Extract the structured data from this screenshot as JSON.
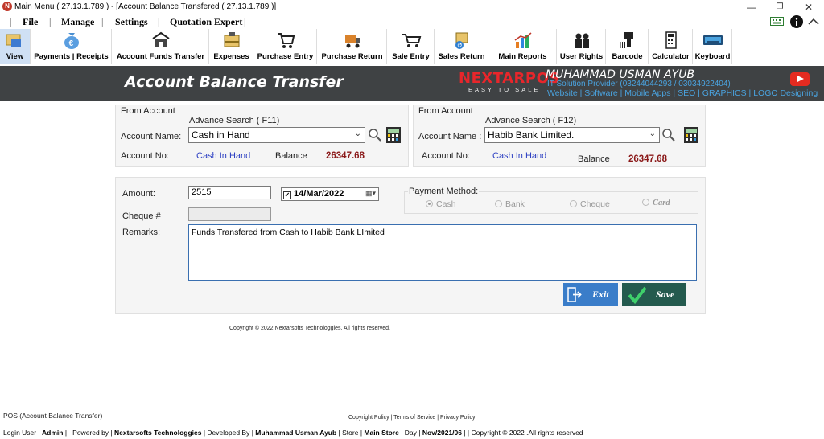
{
  "titlebar": {
    "title": "Main Menu ( 27.13.1.789 ) - [Account Balance Transfered ( 27.13.1.789 )]",
    "logo_letter": "N"
  },
  "menu": {
    "file": "File",
    "manage": "Manage",
    "settings": "Settings",
    "quotation": "Quotation Expert"
  },
  "toolbar": {
    "view": "View",
    "payments": "Payments | Receipts",
    "funds": "Account Funds Transfer",
    "expenses": "Expenses",
    "purchase_entry": "Purchase Entry",
    "purchase_return": "Purchase Return",
    "sale_entry": "Sale Entry",
    "sales_return": "Sales Return",
    "main_reports": "Main Reports",
    "user_rights": "User Rights",
    "barcode": "Barcode",
    "calculator": "Calculator",
    "keyboard": "Keyboard"
  },
  "banner": {
    "title": "Account Balance Transfer",
    "brand": "NEXTARPOS",
    "brand_tagline": "EASY TO SALE",
    "author": "MUHAMMAD USMAN AYUB",
    "author_sub": "IT Solution Provider (03244044293 / 03034922404)",
    "author_links": "Website | Software | Mobile Apps | SEO | GRAPHICS | LOGO Designing"
  },
  "from_account": {
    "group": "From Account",
    "search_label": "Advance Search ( F11)",
    "name_label": "Account Name:",
    "name_value": "Cash in Hand",
    "no_label": "Account No:",
    "no_value": "Cash In Hand",
    "balance_label": "Balance",
    "balance_value": "26347.68"
  },
  "to_account": {
    "group": "From Account",
    "search_label": "Advance Search ( F12)",
    "name_label": "Account Name :",
    "name_value": "Habib Bank Limited.",
    "no_label": "Account No:",
    "no_value": "Cash In Hand",
    "balance_label": "Balance",
    "balance_value": "26347.68"
  },
  "form": {
    "amount_label": "Amount:",
    "amount_value": "2515",
    "date_value": "14/Mar/2022",
    "cheque_label": "Cheque #",
    "remarks_label": "Remarks:",
    "remarks_value": "Funds Transfered from Cash to Habib Bank LImited"
  },
  "payment_method": {
    "label": "Payment Method:",
    "options": [
      "Cash",
      "Bank",
      "Cheque",
      "Card"
    ],
    "selected": "Cash"
  },
  "buttons": {
    "exit": "Exit",
    "save": "Save"
  },
  "copyright": "Copyright © 2022 Nextarsofts Technologgies. All rights reserved.",
  "footer": {
    "left": "POS (Account Balance Transfer)",
    "center": "Copyright Policy | Terms of Service | Privacy Policy"
  },
  "statusbar": {
    "login_label": "Login User",
    "login_value": "Admin",
    "powered_label": "Powered by",
    "powered_value": "Nextarsofts Technologgies",
    "dev_label": "Developed By",
    "dev_value": "Muhammad Usman Ayub",
    "store_label": "Store",
    "store_value": "Main Store",
    "day_label": "Day",
    "day_value": "Nov/2021/06",
    "copyright": "Copyright © 2022  .All rights reserved"
  },
  "colors": {
    "banner_bg": "#3f4244",
    "balance": "#8b1a1a",
    "account_no": "#2b3ec2",
    "exit_btn": "#3a7dc9",
    "save_btn": "#245a4e",
    "brand": "#e8262b"
  }
}
